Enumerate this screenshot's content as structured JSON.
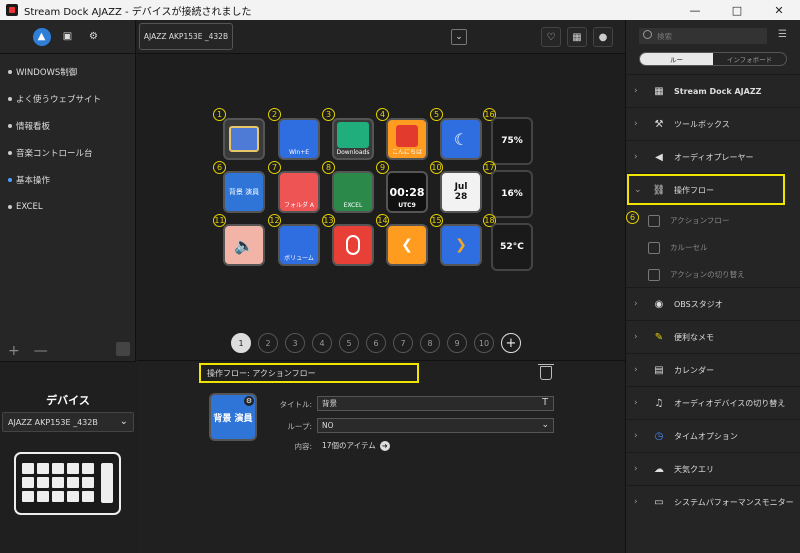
{
  "window": {
    "title": "Stream Dock AJAZZ - デバイスが接続されました"
  },
  "left": {
    "profiles": [
      "WINDOWS制御",
      "よく使うウェブサイト",
      "情報看板",
      "音楽コントロール台",
      "基本操作",
      "EXCEL"
    ],
    "device_heading": "デバイス",
    "device_model": "AJAZZ AKP153E _432B"
  },
  "center": {
    "device_tab": "AJAZZ AKP153E _432B",
    "keys": [
      {
        "n": "1",
        "label": ""
      },
      {
        "n": "2",
        "label": "Win+E"
      },
      {
        "n": "3",
        "label": "Downloads"
      },
      {
        "n": "4",
        "label": "こんにちは"
      },
      {
        "n": "5",
        "label": ""
      },
      {
        "n": "6",
        "label": "背景 演員"
      },
      {
        "n": "7",
        "label": "フォルダ A"
      },
      {
        "n": "8",
        "label": "EXCEL"
      },
      {
        "n": "9",
        "label": "00:28",
        "sub": "UTC9"
      },
      {
        "n": "10",
        "label": "Jul",
        "sub": "28"
      },
      {
        "n": "11",
        "label": ""
      },
      {
        "n": "12",
        "label": "ボリューム"
      },
      {
        "n": "13",
        "label": ""
      },
      {
        "n": "14",
        "label": ""
      },
      {
        "n": "15",
        "label": ""
      }
    ],
    "knobs": [
      {
        "n": "16",
        "value": "75%"
      },
      {
        "n": "17",
        "value": "16%"
      },
      {
        "n": "18",
        "value": "52°C"
      }
    ],
    "pages": [
      "1",
      "2",
      "3",
      "4",
      "5",
      "6",
      "7",
      "8",
      "9",
      "10"
    ],
    "pages_plus": "+",
    "action_title": "操作フロー: アクションフロー",
    "icon_text": "背景 演員",
    "fields": {
      "title_label": "タイトル:",
      "title_value": "背景",
      "title_btn": "T",
      "loop_label": "ループ:",
      "loop_value": "NO",
      "content_label": "内容:",
      "content_value": "17個のアイテム"
    }
  },
  "right": {
    "search_placeholder": "検索",
    "tabs": [
      "ルー",
      "インフォボード"
    ],
    "categories": [
      {
        "name": "Stream Dock AJAZZ",
        "icon": "▦"
      },
      {
        "name": "ツールボックス",
        "icon": "⚒"
      },
      {
        "name": "オーディオプレーヤー",
        "icon": "◀"
      },
      {
        "name": "操作フロー",
        "icon": "⛓"
      },
      {
        "name": "OBSスタジオ",
        "icon": "◉"
      },
      {
        "name": "便利なメモ",
        "icon": "✎"
      },
      {
        "name": "カレンダー",
        "icon": "▤"
      },
      {
        "name": "オーディオデバイスの切り替え",
        "icon": "♫"
      },
      {
        "name": "タイムオプション",
        "icon": "◷"
      },
      {
        "name": "天気クエリ",
        "icon": "☁"
      },
      {
        "name": "システムパフォーマンスモニター",
        "icon": "▭"
      }
    ],
    "subitems": [
      "アクションフロー",
      "カルーセル",
      "アクションの切り替え"
    ],
    "sub_marker": "6"
  }
}
